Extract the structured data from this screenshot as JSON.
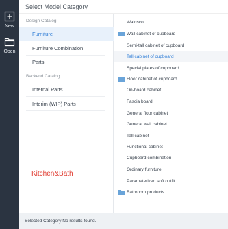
{
  "rail": {
    "new_label": "New",
    "open_label": "Open"
  },
  "header": {
    "title": "Select Model Category"
  },
  "left": {
    "design_catalog_label": "Design Catalog",
    "design_items": [
      "Furniture",
      "Furniture Combination",
      "Parts"
    ],
    "backend_catalog_label": "Backend Catalog",
    "backend_items": [
      "Internal Parts",
      "Interim (WIP) Parts"
    ],
    "brand_text": "Kitchen&Bath"
  },
  "right": {
    "items": [
      {
        "label": "Wainscot",
        "folder": false,
        "selected": false
      },
      {
        "label": "Wall cabinet of cupboard",
        "folder": true,
        "selected": false
      },
      {
        "label": "Semi-tall cabinet of cupboard",
        "folder": false,
        "selected": false
      },
      {
        "label": "Tall cabinet of cupboard",
        "folder": false,
        "selected": true
      },
      {
        "label": "Special plates of cupboard",
        "folder": false,
        "selected": false
      },
      {
        "label": "Floor cabinet of cupboard",
        "folder": true,
        "selected": false
      },
      {
        "label": "On-board cabinet",
        "folder": false,
        "selected": false
      },
      {
        "label": "Fascia board",
        "folder": false,
        "selected": false
      },
      {
        "label": "General floor cabinet",
        "folder": false,
        "selected": false
      },
      {
        "label": "General wall cabinet",
        "folder": false,
        "selected": false
      },
      {
        "label": "Tall cabinet",
        "folder": false,
        "selected": false
      },
      {
        "label": "Functional cabinet",
        "folder": false,
        "selected": false
      },
      {
        "label": "Cupboard combination",
        "folder": false,
        "selected": false
      },
      {
        "label": "Ordinary furniture",
        "folder": false,
        "selected": false
      },
      {
        "label": "Parameterized soft outfit",
        "folder": false,
        "selected": false
      },
      {
        "label": "Bathroom products",
        "folder": true,
        "selected": false
      }
    ]
  },
  "footer": {
    "status": "Selected Category:No results found."
  },
  "colors": {
    "rail_bg": "#2b3441",
    "accent": "#2f7dd6",
    "selected_bg": "#e8f1fb",
    "brand": "#e03c31",
    "folder_icon": "#6aa4d9"
  },
  "icons": {
    "new": "plus-square-icon",
    "open": "folder-open-icon",
    "folder": "folder-icon"
  }
}
